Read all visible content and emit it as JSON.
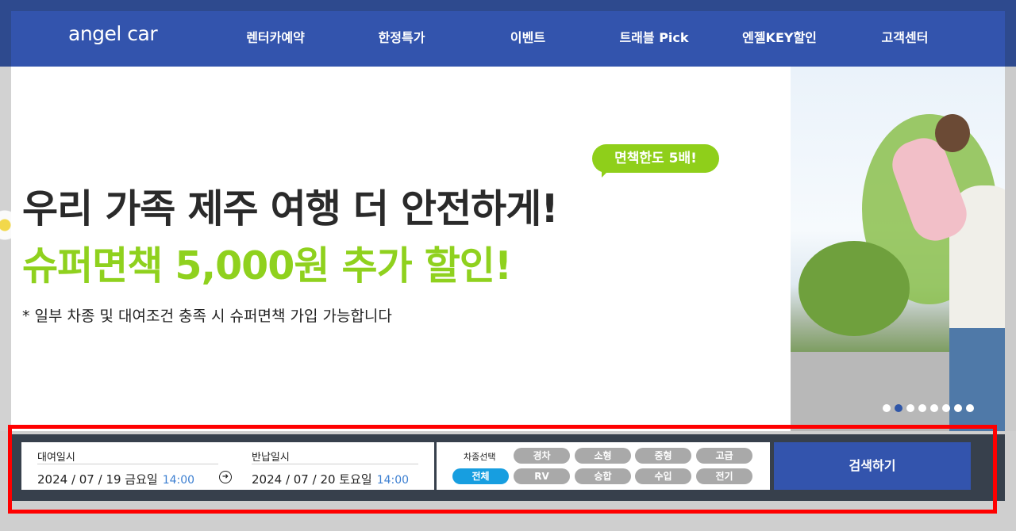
{
  "header": {
    "logo": "angel car",
    "nav": [
      {
        "label": "렌터카예약"
      },
      {
        "label": "한정특가"
      },
      {
        "label": "이벤트"
      },
      {
        "label": "트래블 Pick"
      },
      {
        "label": "엔젤KEY할인"
      },
      {
        "label": "고객센터"
      }
    ]
  },
  "hero": {
    "badge": "면책한도 5배!",
    "headline": "우리 가족 제주 여행 더 안전하게!",
    "subline": "슈퍼면책 5,000원 추가 할인!",
    "note": "* 일부 차종 및 대여조건 충족 시 슈퍼면책 가입 가능합니다",
    "slides": {
      "count": 8,
      "active": 2
    }
  },
  "search": {
    "pickup": {
      "label": "대여일시",
      "date": "2024 / 07 / 19 금요일",
      "time": "14:00"
    },
    "return": {
      "label": "반납일시",
      "date": "2024 / 07 / 20 토요일",
      "time": "14:00"
    },
    "car_type": {
      "title": "차종선택",
      "options": [
        {
          "label": "경차"
        },
        {
          "label": "소형"
        },
        {
          "label": "중형"
        },
        {
          "label": "고급"
        },
        {
          "label": "전체"
        },
        {
          "label": "RV"
        },
        {
          "label": "승합"
        },
        {
          "label": "수입"
        },
        {
          "label": "전기"
        }
      ],
      "selected": "전체"
    },
    "search_button": "검색하기"
  },
  "colors": {
    "nav_bg": "#3354ad",
    "accent_green": "#8fd11e",
    "selected_chip": "#179ee0",
    "highlight_border": "#ff0000"
  }
}
